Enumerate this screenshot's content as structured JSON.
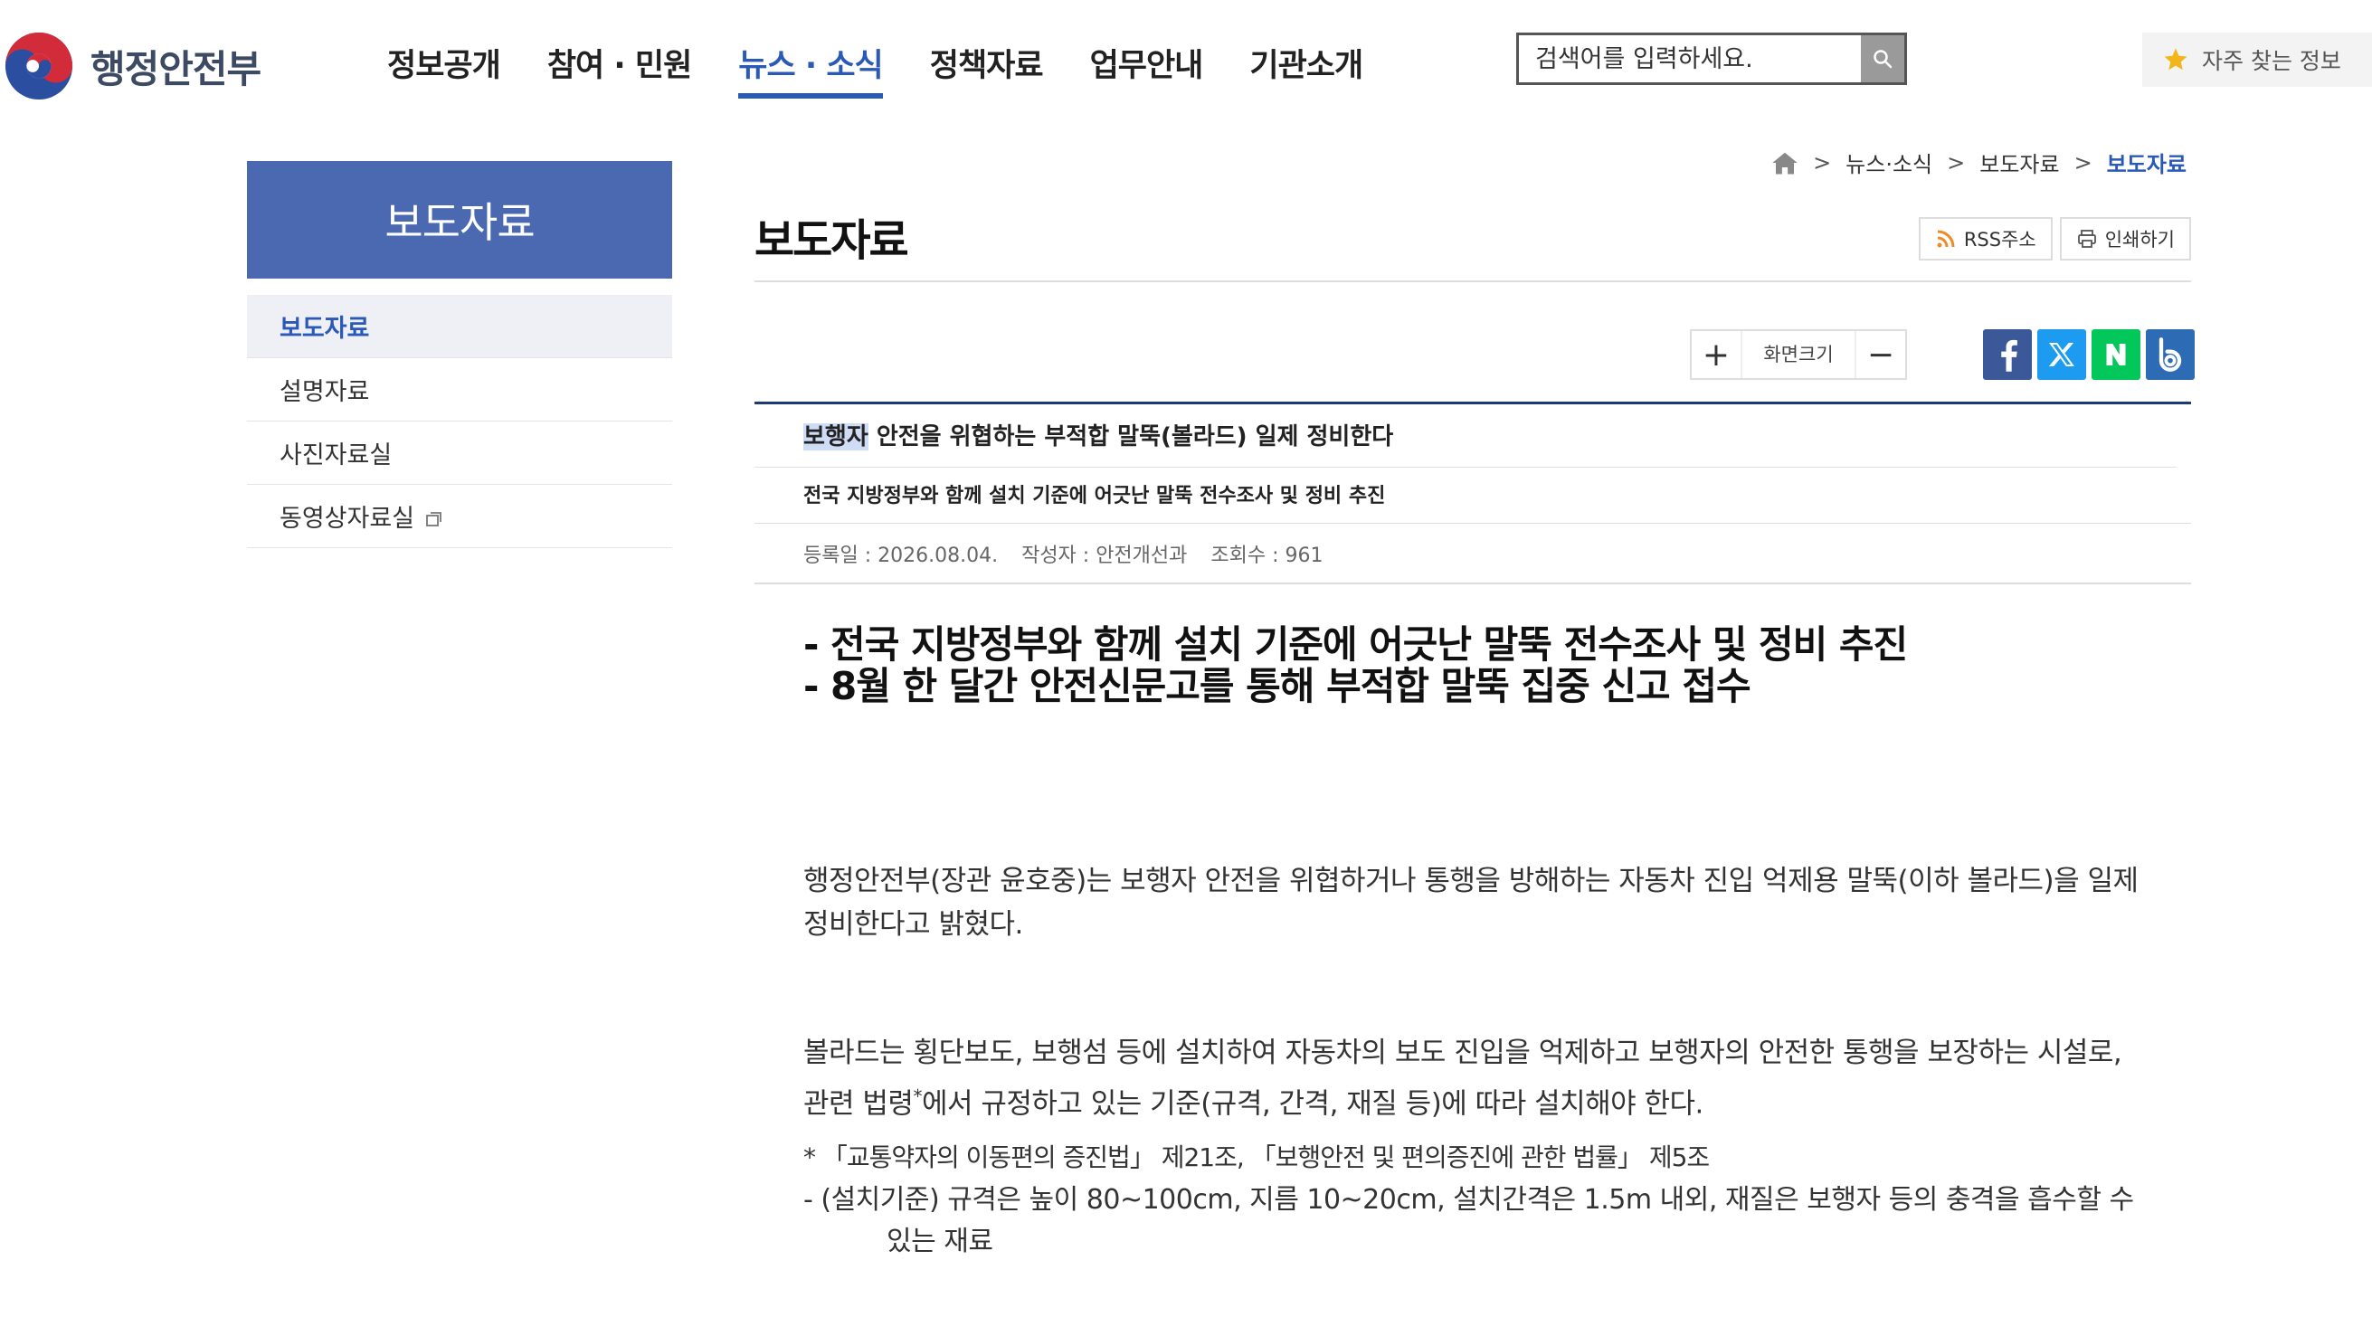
{
  "header": {
    "logo_text": "행정안전부",
    "nav": [
      {
        "label": "정보공개"
      },
      {
        "label": "참여 · 민원"
      },
      {
        "label": "뉴스 · 소식",
        "active": true
      },
      {
        "label": "정책자료"
      },
      {
        "label": "업무안내"
      },
      {
        "label": "기관소개"
      }
    ],
    "search_placeholder": "검색어를 입력하세요.",
    "favorites_label": "자주 찾는 정보"
  },
  "sidebar": {
    "title": "보도자료",
    "items": [
      {
        "label": "보도자료",
        "active": true
      },
      {
        "label": "설명자료"
      },
      {
        "label": "사진자료실"
      },
      {
        "label": "동영상자료실"
      }
    ]
  },
  "breadcrumb": {
    "items": [
      "뉴스·소식",
      "보도자료",
      "보도자료"
    ]
  },
  "page": {
    "title": "보도자료",
    "rss_label": "RSS주소",
    "print_label": "인쇄하기",
    "fontsize_label": "화면크기",
    "plus": "+",
    "minus": "−"
  },
  "article": {
    "title_highlight": "보행자",
    "title_rest": " 안전을 위협하는 부적합 말뚝(볼라드) 일제 정비한다",
    "subtitle": "전국 지방정부와 함께 설치 기준에 어긋난 말뚝 전수조사 및 정비 추진",
    "meta": {
      "date": "등록일 : 2026.08.04.",
      "author": "작성자 : 안전개선과",
      "views": "조회수 : 961"
    },
    "headlines": [
      "- 전국 지방정부와 함께 설치 기준에 어긋난 말뚝 전수조사 및 정비 추진",
      "- 8월 한 달간 안전신문고를 통해 부적합 말뚝 집중 신고 접수"
    ],
    "para1": "행정안전부(장관 윤호중)는 보행자 안전을 위협하거나 통행을 방해하는 자동차 진입 억제용 말뚝(이하 볼라드)을 일제 정비한다고 밝혔다.",
    "para2_a": "볼라드는 횡단보도, 보행섬 등에 설치하여 자동차의 보도 진입을 억제하고 보행자의 안전한 통행을 보장하는 시설로, 관련 법령",
    "para2_sup": "*",
    "para2_b": "에서 규정하고 있는 기준(규격, 간격, 재질 등)에 따라 설치해야 한다.",
    "note1": "* 「교통약자의 이동편의 증진법」 제21조, 「보행안전 및 편의증진에 관한 법률」 제5조",
    "note2_a": "- (설치기준) 규격은 높이 80~100cm, 지름 10~20cm, 설치간격은 1.5m 내외, 재질은 보행자 등의 충격을 흡수할 수",
    "note2_b": "있는 재료"
  },
  "colors": {
    "brand_blue": "#2b59b8",
    "sidebar_title_bg": "#4a69b0",
    "facebook": "#3b5998",
    "x": "#1d9bf0",
    "naver": "#03c75a",
    "band": "#2d6cb5"
  }
}
